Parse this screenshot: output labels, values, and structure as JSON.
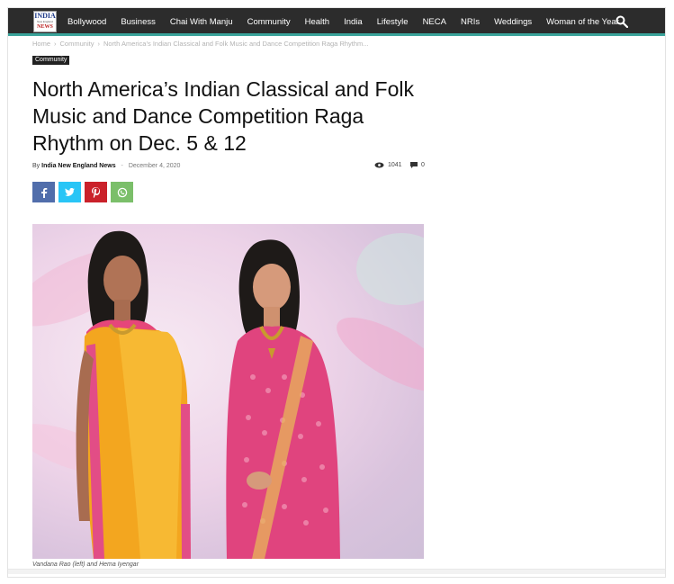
{
  "nav": {
    "logo": {
      "line1": "INDIA",
      "line2": "New England",
      "line3": "NEWS"
    },
    "items": [
      "Bollywood",
      "Business",
      "Chai With Manju",
      "Community",
      "Health",
      "India",
      "Lifestyle",
      "NECA",
      "NRIs",
      "Weddings",
      "Woman of the Year"
    ],
    "search_icon": "search-icon",
    "accent": "#3aa39a"
  },
  "breadcrumb": [
    "Home",
    "Community",
    "North America’s Indian Classical and Folk Music and Dance Competition Raga Rhythm..."
  ],
  "category": "Community",
  "article": {
    "title": "North America’s Indian Classical and Folk Music and Dance Competition Raga Rhythm on Dec. 5 & 12",
    "by": "By",
    "author": "India New England News",
    "date": "December 4, 2020",
    "views": "1041",
    "comments": "0"
  },
  "share": [
    {
      "name": "facebook",
      "glyph": "f",
      "color": "#516eab"
    },
    {
      "name": "twitter",
      "glyph": "t",
      "color": "#29c5f6"
    },
    {
      "name": "pinterest",
      "glyph": "p",
      "color": "#ca212a"
    },
    {
      "name": "whatsapp",
      "glyph": "w",
      "color": "#7bbf6a"
    }
  ],
  "photo": {
    "caption": "Vandana Rao (left) and Hema Iyengar"
  }
}
